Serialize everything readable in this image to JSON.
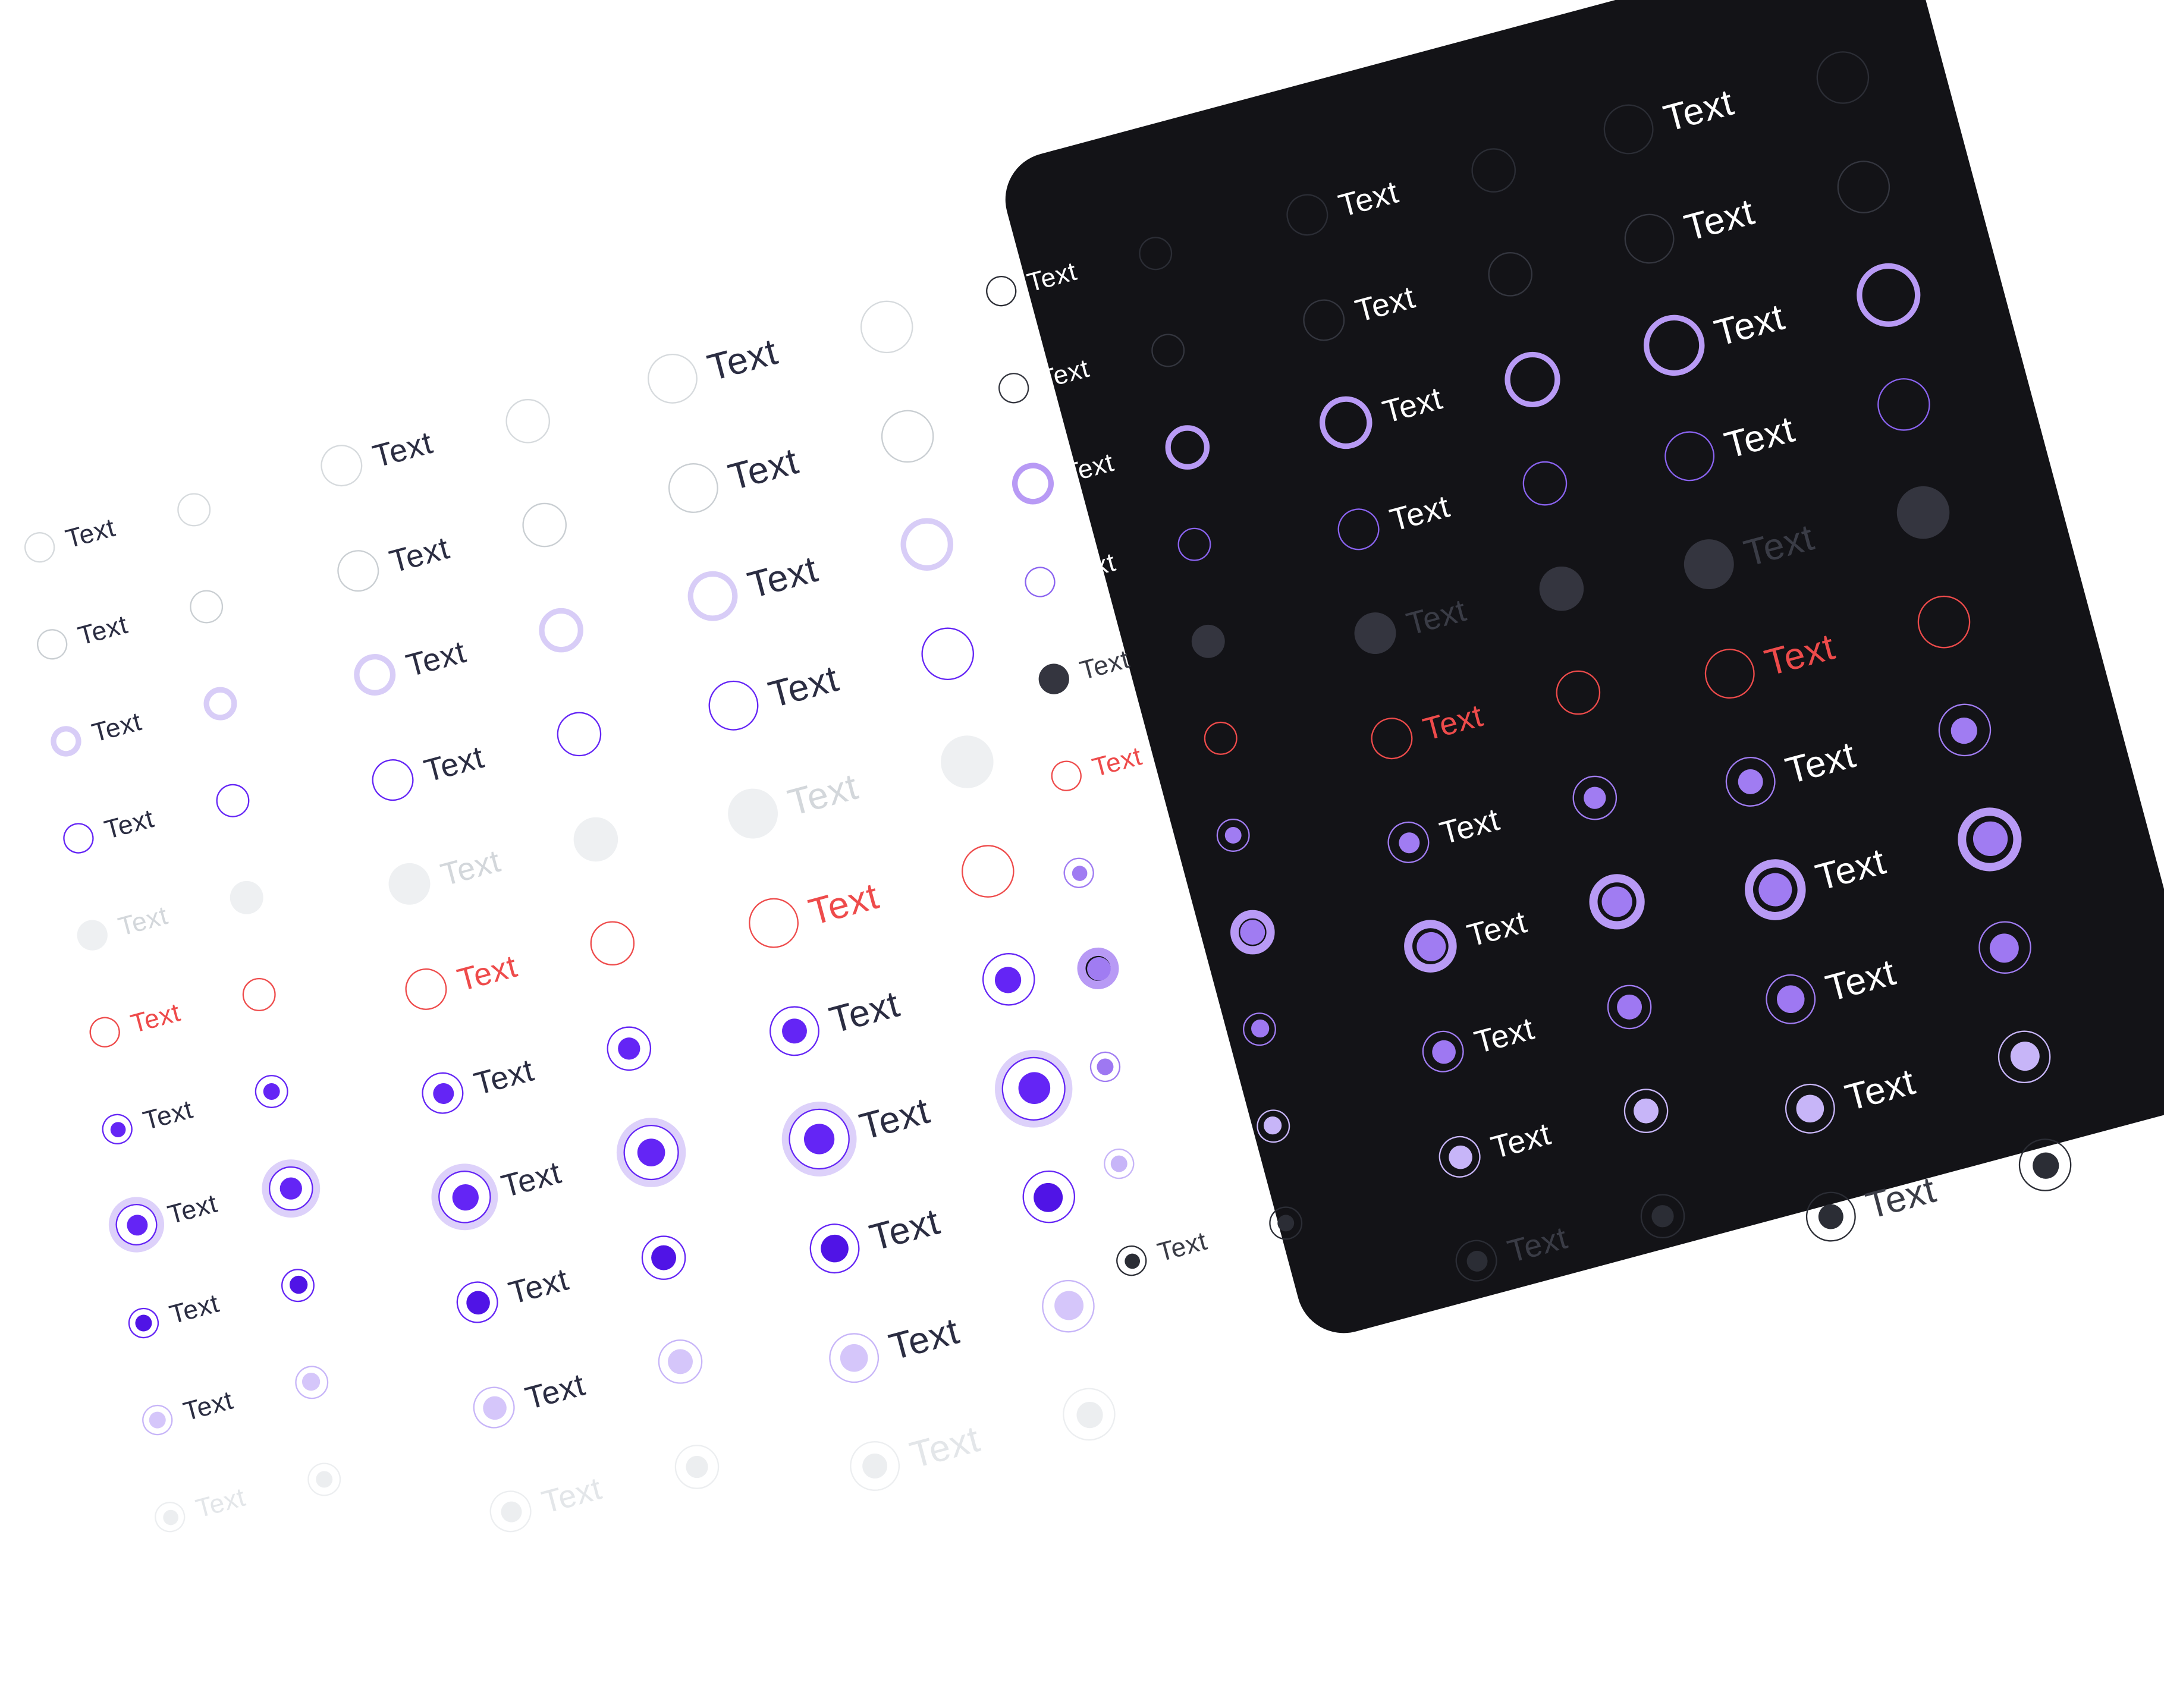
{
  "item_label": "Text",
  "light_theme": {
    "background": "#ffffff",
    "text_color": "#2b2d42",
    "columns": [
      {
        "size": "small",
        "states": [
          "default",
          "hover",
          "focus",
          "active",
          "disabled",
          "error",
          "checked",
          "checked-focus",
          "checked-hover",
          "checked-active",
          "checked-disabled"
        ]
      },
      {
        "size": "medium",
        "states": [
          "default",
          "hover",
          "focus",
          "active",
          "disabled",
          "error",
          "checked",
          "checked-focus",
          "checked-hover",
          "checked-active",
          "checked-disabled"
        ]
      },
      {
        "size": "large",
        "states": [
          "default",
          "hover",
          "focus",
          "active",
          "disabled",
          "error",
          "checked",
          "checked-focus",
          "checked-hover",
          "checked-active",
          "checked-disabled"
        ]
      }
    ]
  },
  "dark_theme": {
    "background": "#131317",
    "text_color": "#ffffff",
    "columns": [
      {
        "size": "small",
        "states": [
          "default",
          "hover",
          "focus",
          "active",
          "disabled",
          "error",
          "checked",
          "checked-focus",
          "checked-hover",
          "checked-active",
          "checked-disabled"
        ]
      },
      {
        "size": "medium",
        "states": [
          "default",
          "hover",
          "focus",
          "active",
          "disabled",
          "error",
          "checked",
          "checked-focus",
          "checked-hover",
          "checked-active",
          "checked-disabled"
        ]
      },
      {
        "size": "large",
        "states": [
          "default",
          "hover",
          "focus",
          "active",
          "disabled",
          "error",
          "checked",
          "checked-focus",
          "checked-hover",
          "checked-active",
          "checked-disabled"
        ]
      }
    ]
  },
  "colors": {
    "primary": "#6425f5",
    "primary_light": "#c7b5f8",
    "primary_dark_mode": "#a07cf2",
    "error": "#ee4b4b",
    "neutral_border": "#d6dadd",
    "disabled_fill": "#eef0f2",
    "dark_neutral": "#2b2d35"
  }
}
